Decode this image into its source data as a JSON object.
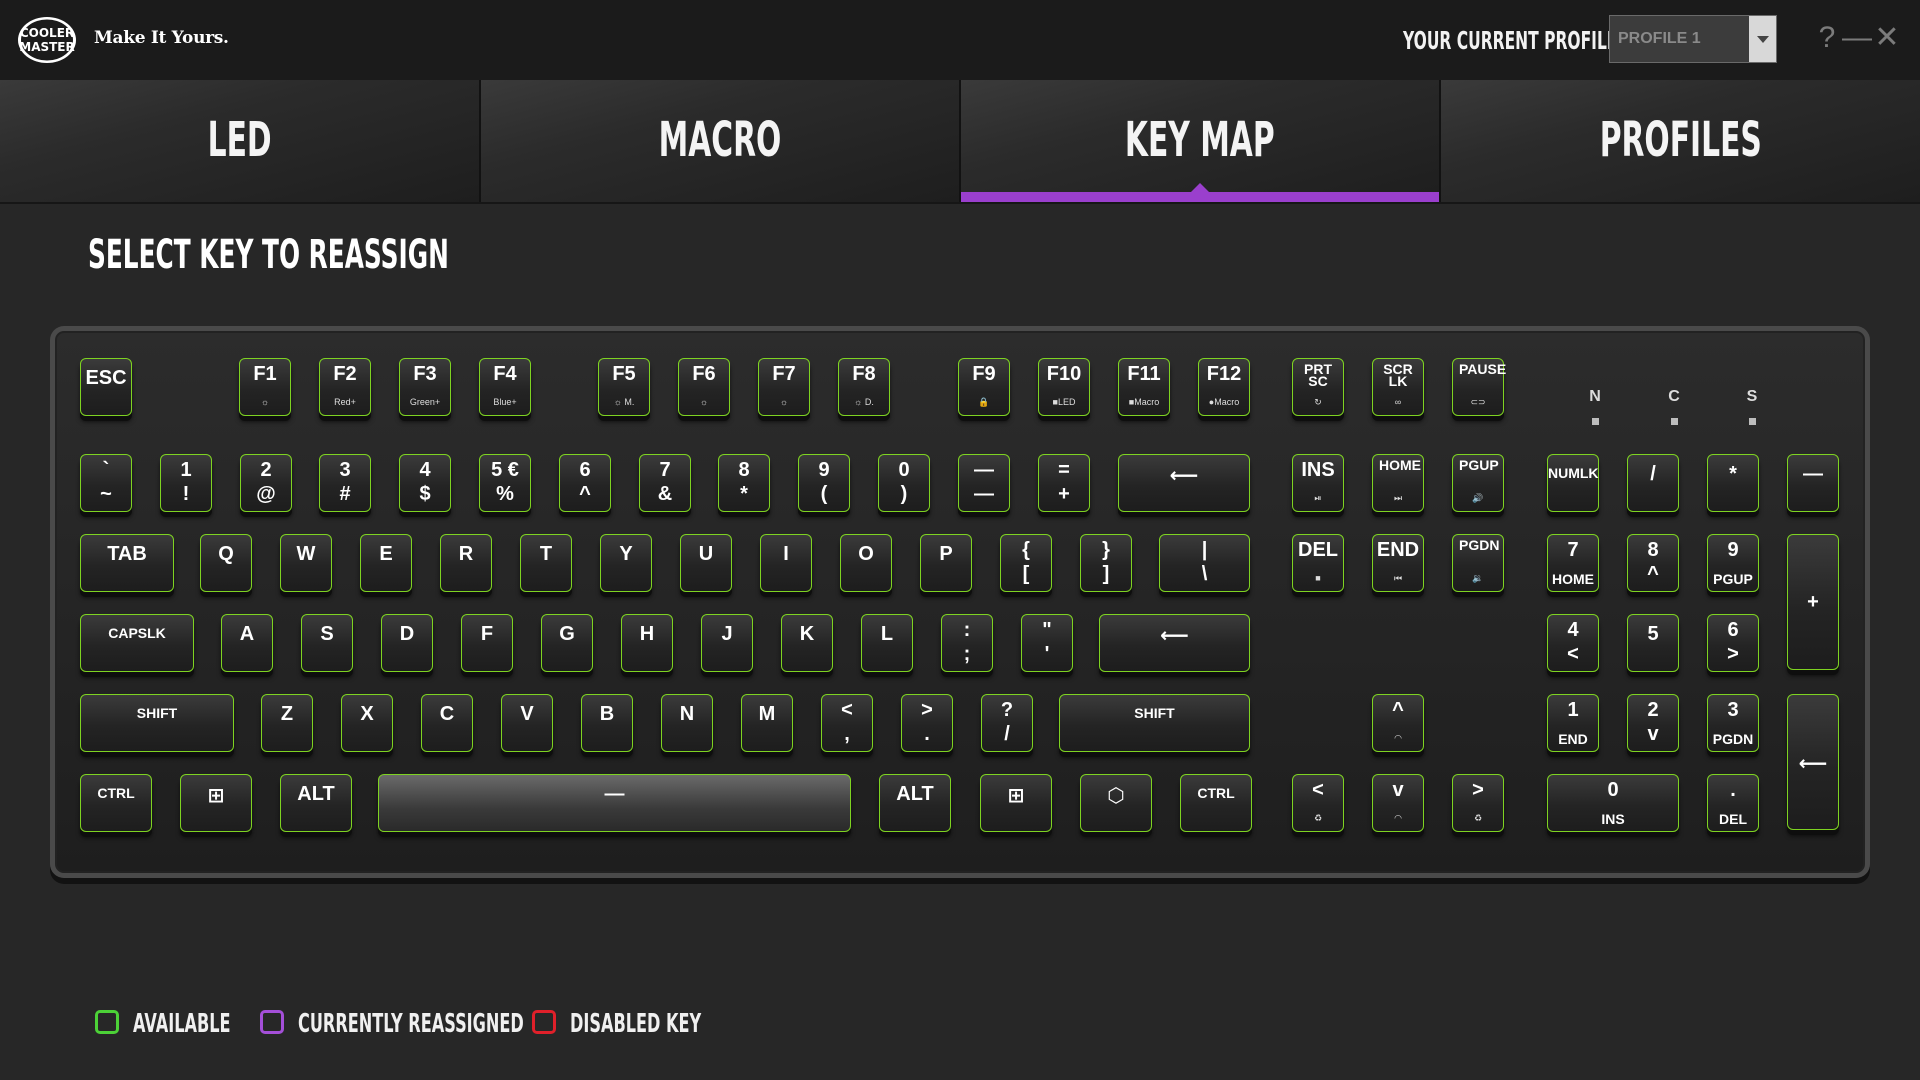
{
  "app": {
    "logo_text": "COOLER MASTER",
    "tagline": "Make It Yours."
  },
  "header": {
    "current_profile_label": "YOUR CURRENT PROFILE",
    "profile_value": "PROFILE 1",
    "help": "?",
    "minimize": "—",
    "close": "✕"
  },
  "tabs": [
    {
      "label": "LED"
    },
    {
      "label": "MACRO"
    },
    {
      "label": "KEY MAP",
      "active": true
    },
    {
      "label": "PROFILES"
    }
  ],
  "section_title": "SELECT KEY TO REASSIGN",
  "indicators": [
    "N",
    "C",
    "S"
  ],
  "keys": {
    "esc": {
      "main": "ESC"
    },
    "f1": {
      "main": "F1",
      "sub": "☼"
    },
    "f2": {
      "main": "F2",
      "sub": "Red+"
    },
    "f3": {
      "main": "F3",
      "sub": "Green+"
    },
    "f4": {
      "main": "F4",
      "sub": "Blue+"
    },
    "f5": {
      "main": "F5",
      "sub": "☼ M."
    },
    "f6": {
      "main": "F6",
      "sub": "☼"
    },
    "f7": {
      "main": "F7",
      "sub": "☼"
    },
    "f8": {
      "main": "F8",
      "sub": "☼ D."
    },
    "f9": {
      "main": "F9",
      "sub": "🔒"
    },
    "f10": {
      "main": "F10",
      "sub": "■LED"
    },
    "f11": {
      "main": "F11",
      "sub": "■Macro"
    },
    "f12": {
      "main": "F12",
      "sub": "●Macro"
    },
    "prtsc": {
      "main": "PRT SC",
      "sub": "↻"
    },
    "scrlk": {
      "main": "SCR LK",
      "sub": "∞"
    },
    "pause": {
      "main": "PAUSE",
      "sub": "⊂⊃"
    },
    "grave": {
      "top": "`",
      "bottom": "~"
    },
    "n1": {
      "top": "1",
      "bottom": "!"
    },
    "n2": {
      "top": "2",
      "bottom": "@"
    },
    "n3": {
      "top": "3",
      "bottom": "#"
    },
    "n4": {
      "top": "4",
      "bottom": "$"
    },
    "n5": {
      "top": "5 €",
      "bottom": "%"
    },
    "n6": {
      "top": "6",
      "bottom": "^"
    },
    "n7": {
      "top": "7",
      "bottom": "&"
    },
    "n8": {
      "top": "8",
      "bottom": "*"
    },
    "n9": {
      "top": "9",
      "bottom": "("
    },
    "n0": {
      "top": "0",
      "bottom": ")"
    },
    "minus": {
      "top": "—",
      "bottom": "—"
    },
    "equal": {
      "top": "=",
      "bottom": "+"
    },
    "backspace": {
      "main": "⟵"
    },
    "ins": {
      "main": "INS",
      "sub": "⏯"
    },
    "home": {
      "main": "HOME",
      "sub": "⏭"
    },
    "pgup": {
      "main": "PGUP",
      "sub": "🔊"
    },
    "numlk": {
      "main": "NUMLK"
    },
    "kp_div": {
      "main": "/"
    },
    "kp_mul": {
      "main": "*"
    },
    "kp_minus": {
      "main": "—"
    },
    "tab": {
      "main": "TAB"
    },
    "q": {
      "main": "Q"
    },
    "w": {
      "main": "W"
    },
    "e": {
      "main": "E"
    },
    "r": {
      "main": "R"
    },
    "t": {
      "main": "T"
    },
    "y": {
      "main": "Y"
    },
    "u": {
      "main": "U"
    },
    "i": {
      "main": "I"
    },
    "o": {
      "main": "O"
    },
    "p": {
      "main": "P"
    },
    "lbrace": {
      "top": "{",
      "bottom": "["
    },
    "rbrace": {
      "top": "}",
      "bottom": "]"
    },
    "backslash": {
      "top": "|",
      "bottom": "\\"
    },
    "del": {
      "main": "DEL",
      "sub": "■"
    },
    "end": {
      "main": "END",
      "sub": "⏮"
    },
    "pgdn": {
      "main": "PGDN",
      "sub": "🔉"
    },
    "kp7": {
      "top": "7",
      "bottom": "HOME"
    },
    "kp8": {
      "top": "8",
      "bottom": "^"
    },
    "kp9": {
      "top": "9",
      "bottom": "PGUP"
    },
    "kp_plus": {
      "main": "+"
    },
    "capslk": {
      "main": "CAPSLK"
    },
    "a": {
      "main": "A"
    },
    "s": {
      "main": "S"
    },
    "d": {
      "main": "D"
    },
    "f": {
      "main": "F"
    },
    "g": {
      "main": "G"
    },
    "h": {
      "main": "H"
    },
    "j": {
      "main": "J"
    },
    "k": {
      "main": "K"
    },
    "l": {
      "main": "L"
    },
    "semicolon": {
      "top": ":",
      "bottom": ";"
    },
    "quote": {
      "top": "\"",
      "bottom": "'"
    },
    "enter": {
      "main": "⟵"
    },
    "kp4": {
      "top": "4",
      "bottom": "<"
    },
    "kp5": {
      "main": "5"
    },
    "kp6": {
      "top": "6",
      "bottom": ">"
    },
    "lshift": {
      "main": "SHIFT"
    },
    "z": {
      "main": "Z"
    },
    "x": {
      "main": "X"
    },
    "c": {
      "main": "C"
    },
    "v": {
      "main": "V"
    },
    "b": {
      "main": "B"
    },
    "n": {
      "main": "N"
    },
    "m": {
      "main": "M"
    },
    "comma": {
      "top": "<",
      "bottom": ","
    },
    "period": {
      "top": ">",
      "bottom": "."
    },
    "slash": {
      "top": "?",
      "bottom": "/"
    },
    "rshift": {
      "main": "SHIFT"
    },
    "up": {
      "main": "^",
      "sub": "◠"
    },
    "kp1": {
      "top": "1",
      "bottom": "END"
    },
    "kp2": {
      "top": "2",
      "bottom": "v"
    },
    "kp3": {
      "top": "3",
      "bottom": "PGDN"
    },
    "kp_enter": {
      "main": "⟵"
    },
    "lctrl": {
      "main": "CTRL"
    },
    "lwin": {
      "main": "⊞"
    },
    "lalt": {
      "main": "ALT"
    },
    "space": {
      "main": "—"
    },
    "ralt": {
      "main": "ALT"
    },
    "rwin": {
      "main": "⊞"
    },
    "fn": {
      "main": "⬡"
    },
    "rctrl": {
      "main": "CTRL"
    },
    "left": {
      "main": "<",
      "sub": "♻"
    },
    "down": {
      "main": "v",
      "sub": "◠"
    },
    "right": {
      "main": ">",
      "sub": "♻"
    },
    "kp0": {
      "top": "0",
      "bottom": "INS"
    },
    "kp_dot": {
      "top": ".",
      "bottom": "DEL"
    }
  },
  "legend": [
    {
      "label": "AVAILABLE",
      "color": "#4cd137"
    },
    {
      "label": "CURRENTLY REASSIGNED",
      "color": "#a44fd8"
    },
    {
      "label": "DISABLED KEY",
      "color": "#e0202a"
    }
  ],
  "colors": {
    "available": "#7ed321",
    "accent": "#9a3fcd"
  }
}
